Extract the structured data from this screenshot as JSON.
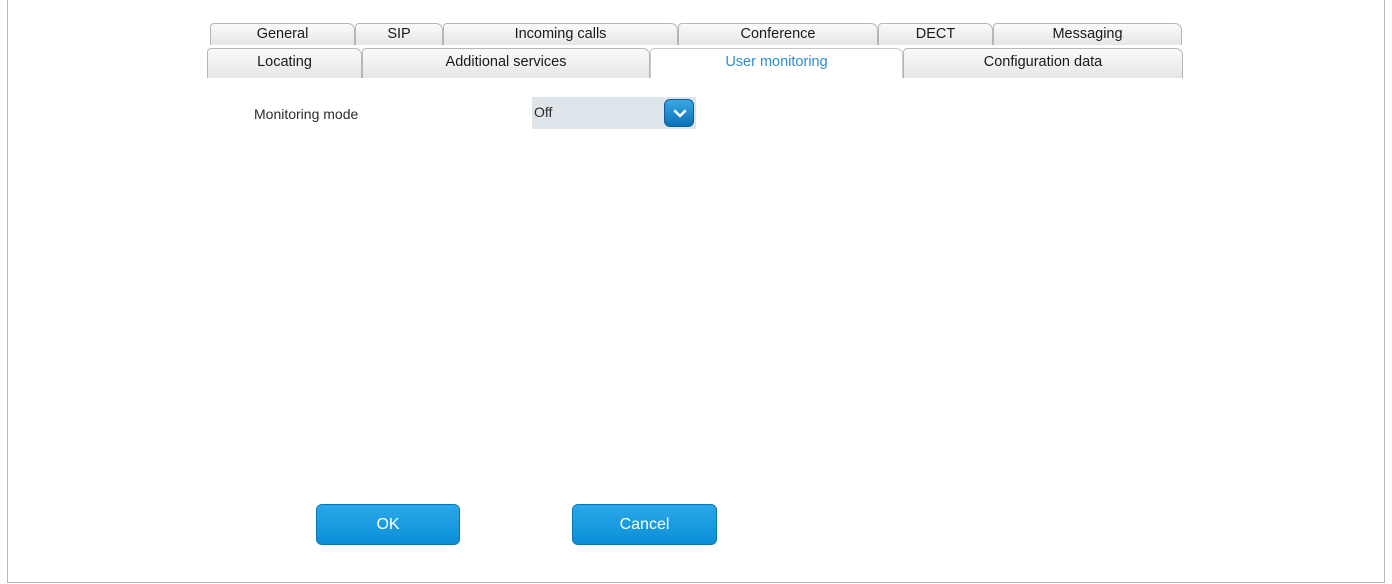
{
  "tabs_row1": [
    {
      "label": "General"
    },
    {
      "label": "SIP"
    },
    {
      "label": "Incoming calls"
    },
    {
      "label": "Conference"
    },
    {
      "label": "DECT"
    },
    {
      "label": "Messaging"
    }
  ],
  "tabs_row2": [
    {
      "label": "Locating"
    },
    {
      "label": "Additional services"
    },
    {
      "label": "User monitoring",
      "active": true
    },
    {
      "label": "Configuration data"
    }
  ],
  "form": {
    "monitoring_mode": {
      "label": "Monitoring mode",
      "value": "Off"
    }
  },
  "buttons": {
    "ok_label": "OK",
    "cancel_label": "Cancel"
  },
  "colors": {
    "accent": "#0a8fd6",
    "active_tab_text": "#2a8fcf",
    "select_bg": "#dde4ea"
  }
}
